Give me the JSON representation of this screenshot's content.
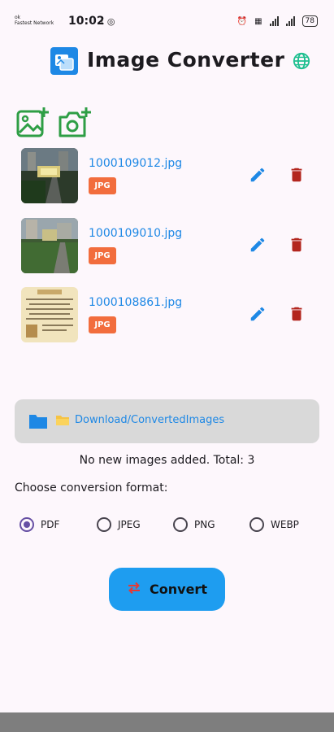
{
  "status_bar": {
    "carrier_top": "ok",
    "carrier": "Fastest Network",
    "time": "10:02",
    "battery": "78"
  },
  "app": {
    "title": "Image Converter"
  },
  "files": [
    {
      "name": "1000109012.jpg",
      "type": "JPG"
    },
    {
      "name": "1000109010.jpg",
      "type": "JPG"
    },
    {
      "name": "1000108861.jpg",
      "type": "JPG"
    }
  ],
  "output": {
    "folder_path": "Download/ConvertedImages"
  },
  "status_message": "No new images added. Total: 3",
  "format": {
    "prompt": "Choose conversion format:",
    "options": [
      "PDF",
      "JPEG",
      "PNG",
      "WEBP"
    ],
    "selected": "PDF"
  },
  "convert_button": {
    "label": "Convert"
  },
  "colors": {
    "accent": "#1e88e5",
    "badge": "#f26d3d",
    "delete": "#b3261e",
    "add_icons": "#2e9e45",
    "radio_selected": "#6750a4",
    "button": "#1e9df0"
  },
  "icons": [
    "add-photo-icon",
    "add-camera-icon",
    "edit-icon",
    "delete-icon",
    "folder-icon",
    "globe-icon",
    "swap-icon"
  ]
}
